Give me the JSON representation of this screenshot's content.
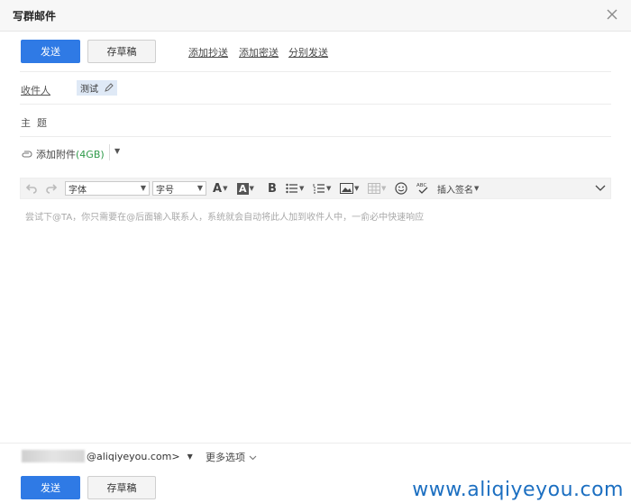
{
  "window": {
    "title": "写群邮件"
  },
  "toolbar_top": {
    "send_label": "发送",
    "draft_label": "存草稿",
    "links": [
      "添加抄送",
      "添加密送",
      "分别发送"
    ]
  },
  "recipients": {
    "label": "收件人",
    "chips": [
      "测试"
    ]
  },
  "subject": {
    "label": "主  题",
    "value": ""
  },
  "attachment": {
    "label": "添加附件",
    "size": "(4GB)"
  },
  "editor_toolbar": {
    "font_select": "字体",
    "size_select": "字号",
    "signature_label": "插入签名",
    "icons": [
      "undo-icon",
      "redo-icon",
      "font-color-icon",
      "highlight-icon",
      "bold-icon",
      "bullet-list-icon",
      "numbered-list-icon",
      "image-icon",
      "table-icon",
      "emoji-icon",
      "spellcheck-icon",
      "collapse-chevron-icon"
    ]
  },
  "editor": {
    "placeholder": "尝试下@TA，你只需要在@后面输入联系人，系统就会自动将此人加到收件人中，一俞必中快速响应"
  },
  "footer": {
    "sender_address": "@aliqiyeyou.com>",
    "more_options": "更多选项",
    "send_label": "发送",
    "draft_label": "存草稿"
  },
  "watermark": {
    "text": "www.aliqiyeyou.com"
  },
  "colors": {
    "primary": "#2f7ae5",
    "attachment_size": "#2f9a4a",
    "watermark": "#1c6fc1"
  }
}
